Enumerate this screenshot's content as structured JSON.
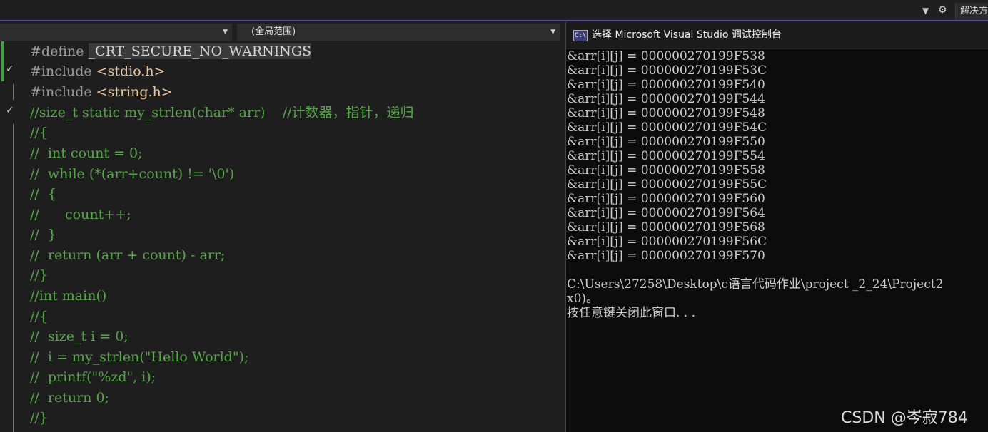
{
  "toolbar": {
    "solution_explorer_label": "解决方"
  },
  "nav": {
    "left_scope": "",
    "right_scope": "(全局范围)"
  },
  "editor": {
    "lines": [
      "#define _CRT_SECURE_NO_WARNINGS",
      "#include <stdio.h>",
      "#include <string.h>",
      "//size_t static my_strlen(char* arr)    //计数器，指针，递归",
      "//{",
      "//  int count = 0;",
      "//  while (*(arr+count) != '\\0')",
      "//  {",
      "//      count++;",
      "//  }",
      "//  return (arr + count) - arr;",
      "//}",
      "//int main()",
      "//{",
      "//  size_t i = 0;",
      "//  i = my_strlen(\"Hello World\");",
      "//  printf(\"%zd\", i);",
      "//  return 0;",
      "//}"
    ],
    "define_keyword": "#define",
    "define_name": "_CRT_SECURE_NO_WARNINGS",
    "include_keyword": "#include",
    "include_1": "<stdio.h>",
    "include_2": "<string.h>"
  },
  "console": {
    "title": "选择 Microsoft Visual Studio 调试控制台",
    "icon_text": "C:\\",
    "output": [
      "&arr[i][j] = 000000270199F538",
      "&arr[i][j] = 000000270199F53C",
      "&arr[i][j] = 000000270199F540",
      "&arr[i][j] = 000000270199F544",
      "&arr[i][j] = 000000270199F548",
      "&arr[i][j] = 000000270199F54C",
      "&arr[i][j] = 000000270199F550",
      "&arr[i][j] = 000000270199F554",
      "&arr[i][j] = 000000270199F558",
      "&arr[i][j] = 000000270199F55C",
      "&arr[i][j] = 000000270199F560",
      "&arr[i][j] = 000000270199F564",
      "&arr[i][j] = 000000270199F568",
      "&arr[i][j] = 000000270199F56C",
      "&arr[i][j] = 000000270199F570",
      "",
      "C:\\Users\\27258\\Desktop\\c语言代码作业\\project _2_24\\Project2",
      "x0)。",
      "按任意键关闭此窗口. . ."
    ]
  },
  "watermark": "CSDN @岑寂784",
  "colors": {
    "comment": "#57a64a",
    "include_path": "#e8c9a5",
    "preprocessor": "#9b9b9b",
    "change_bar": "#46a146",
    "accent": "#5b4a9a"
  }
}
